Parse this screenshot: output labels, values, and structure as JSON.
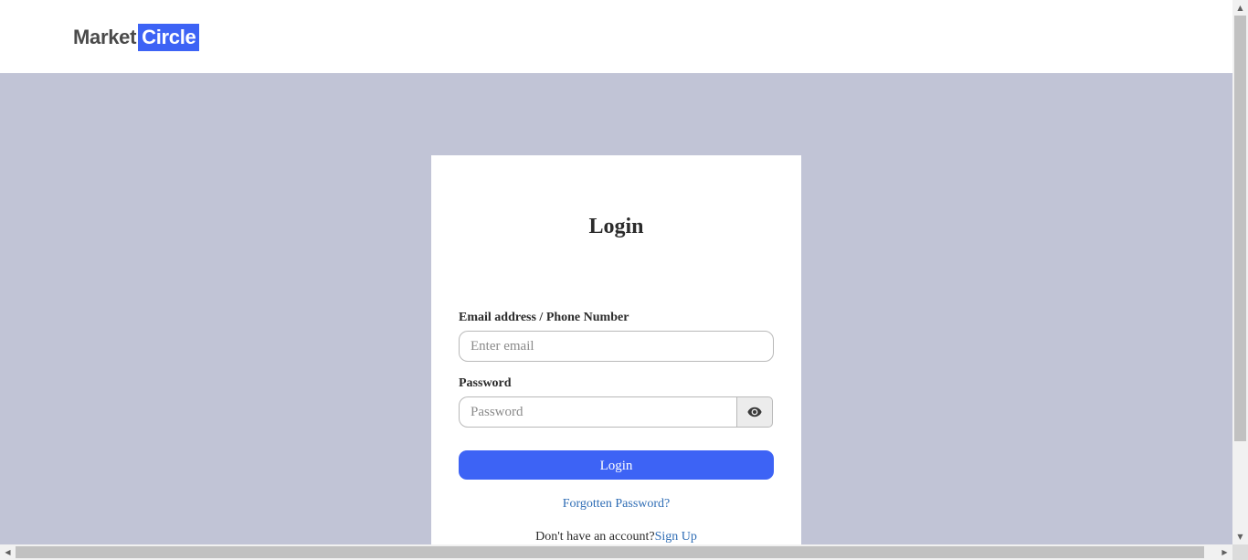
{
  "header": {
    "logo_part1": "Market",
    "logo_part2": "Circle"
  },
  "login_form": {
    "title": "Login",
    "email_label": "Email address / Phone Number",
    "email_placeholder": "Enter email",
    "email_value": "",
    "password_label": "Password",
    "password_placeholder": "Password",
    "password_value": "",
    "toggle_icon": "eye-icon",
    "login_button_label": "Login",
    "forgot_password_link": "Forgotten Password?",
    "signup_prompt": "Don't have an account?",
    "signup_link": "Sign Up"
  },
  "colors": {
    "accent": "#3d63f5",
    "page_background": "#c1c4d6",
    "link": "#2f6db5"
  }
}
